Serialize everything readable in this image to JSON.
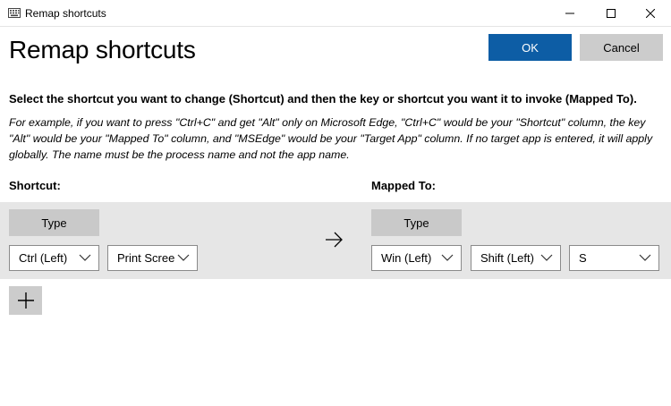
{
  "window": {
    "title": "Remap shortcuts",
    "minimize_icon": "minimize-icon",
    "maximize_icon": "maximize-icon",
    "close_icon": "close-icon"
  },
  "header": {
    "title": "Remap shortcuts",
    "ok_label": "OK",
    "cancel_label": "Cancel",
    "ok_color": "#0d5da5"
  },
  "instructions": {
    "bold": "Select the shortcut you want to change (Shortcut) and then the key or shortcut you want it to invoke (Mapped To).",
    "italic": "For example, if you want to press \"Ctrl+C\" and get \"Alt\" only on Microsoft Edge, \"Ctrl+C\" would be your \"Shortcut\" column, the key \"Alt\" would be your \"Mapped To\" column, and \"MSEdge\" would be your \"Target App\" column. If no target app is entered, it will apply globally. The name must be the process name and not the app name."
  },
  "columns": {
    "shortcut": "Shortcut:",
    "mapped_to": "Mapped To:"
  },
  "row": {
    "shortcut": {
      "type_label": "Type",
      "keys": [
        "Ctrl (Left)",
        "Print Screen"
      ]
    },
    "arrow_icon": "arrow-right-icon",
    "mapped": {
      "type_label": "Type",
      "keys": [
        "Win (Left)",
        "Shift (Left)",
        "S"
      ]
    }
  },
  "add_button": {
    "icon": "plus-icon"
  }
}
